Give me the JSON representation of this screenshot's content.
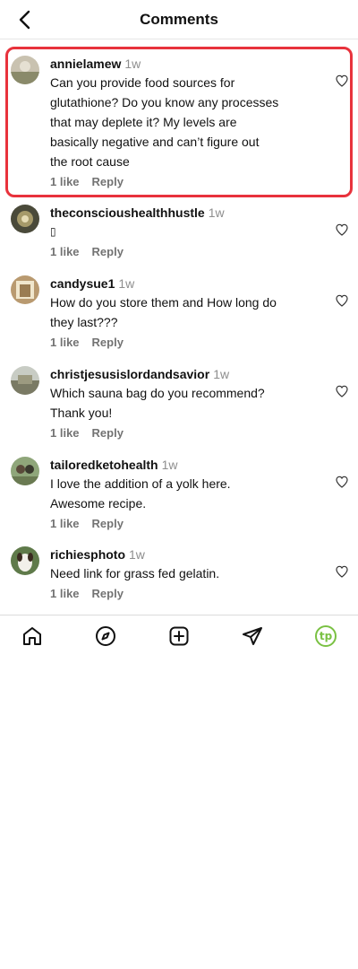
{
  "header": {
    "title": "Comments"
  },
  "comments": [
    {
      "username": "annielamew",
      "time": "1w",
      "text": [
        "Can you provide food sources for",
        "glutathione? Do you know any processes",
        "that may deplete it? My levels are",
        "basically negative and can’t figure out",
        "the root cause"
      ],
      "likes": "1 like",
      "reply": "Reply"
    },
    {
      "username": "theconscioushealthhustle",
      "time": "1w",
      "text": [
        "▯"
      ],
      "likes": "1 like",
      "reply": "Reply"
    },
    {
      "username": "candysue1",
      "time": "1w",
      "text": [
        "How do you store them and How long do",
        "they last???"
      ],
      "likes": "1 like",
      "reply": "Reply"
    },
    {
      "username": "christjesusislordandsavior",
      "time": "1w",
      "text": [
        "Which sauna bag do you recommend?",
        "Thank you!"
      ],
      "likes": "1 like",
      "reply": "Reply"
    },
    {
      "username": "tailoredketohealth",
      "time": "1w",
      "text": [
        "I love the addition of a yolk here.",
        "Awesome recipe."
      ],
      "likes": "1 like",
      "reply": "Reply"
    },
    {
      "username": "richiesphoto",
      "time": "1w",
      "text": [
        "Need link for grass fed gelatin."
      ],
      "likes": "1 like",
      "reply": "Reply"
    }
  ],
  "nav": {
    "profile_badge": "tp"
  },
  "colors": {
    "highlight": "#e8323c",
    "accent": "#7ac143",
    "muted": "#737373"
  },
  "icons": [
    "back-chevron-icon",
    "heart-icon",
    "home-icon",
    "compass-icon",
    "plus-square-icon",
    "send-icon"
  ]
}
